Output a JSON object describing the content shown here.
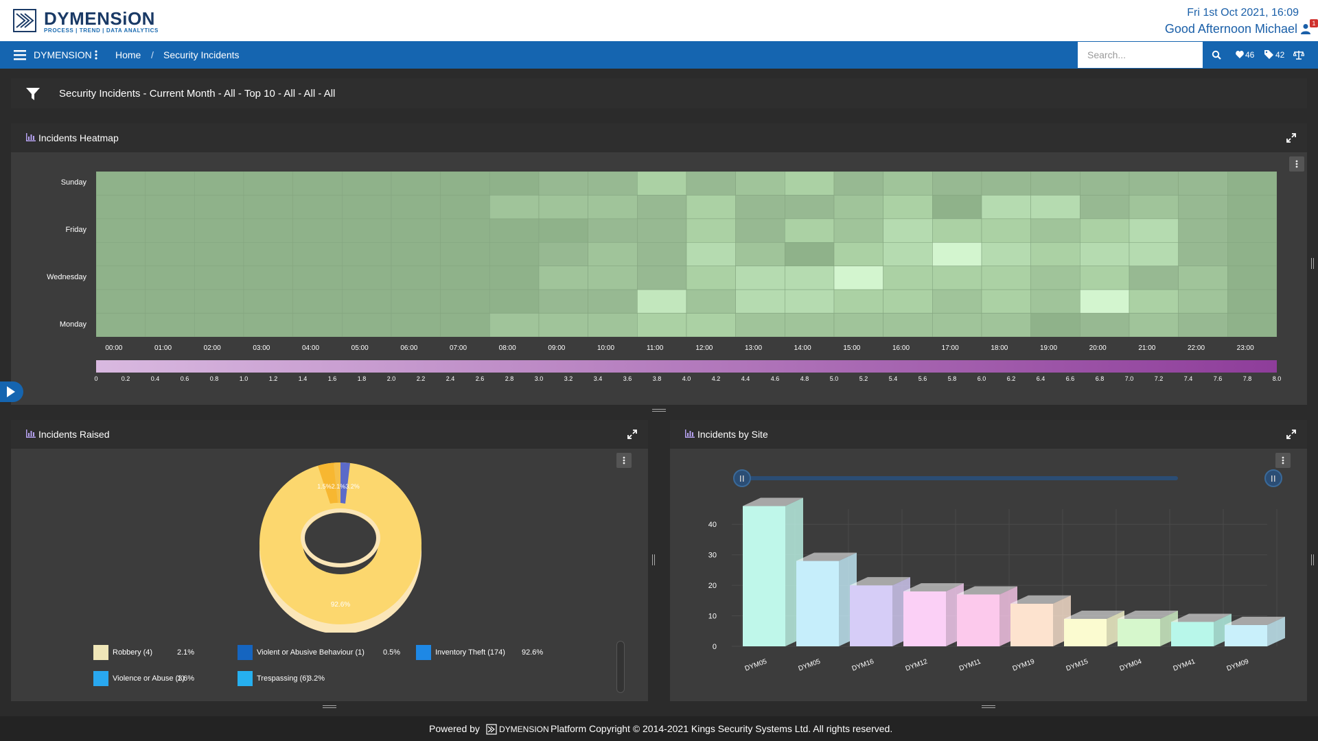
{
  "header": {
    "brand": "DYMENSiON",
    "tagline": "PROCESS | TREND | DATA ANALYTICS",
    "datetime": "Fri 1st Oct 2021, 16:09",
    "greeting": "Good Afternoon Michael",
    "notification_count": "1"
  },
  "nav": {
    "brand": "DYMENSION",
    "home": "Home",
    "separator": "/",
    "current": "Security Incidents",
    "search_placeholder": "Search...",
    "likes_count": "46",
    "tags_count": "42"
  },
  "filter": {
    "text": "Security Incidents - Current Month - All - Top 10 - All - All - All"
  },
  "heatmap": {
    "title": "Incidents Heatmap",
    "day_labels": [
      "Sunday",
      "Friday",
      "Wednesday",
      "Monday"
    ],
    "hour_labels": [
      "00:00",
      "01:00",
      "02:00",
      "03:00",
      "04:00",
      "05:00",
      "06:00",
      "07:00",
      "08:00",
      "09:00",
      "10:00",
      "11:00",
      "12:00",
      "13:00",
      "14:00",
      "15:00",
      "16:00",
      "17:00",
      "18:00",
      "19:00",
      "20:00",
      "21:00",
      "22:00",
      "23:00"
    ],
    "scale_labels": [
      "0",
      "0.2",
      "0.4",
      "0.6",
      "0.8",
      "1.0",
      "1.2",
      "1.4",
      "1.6",
      "1.8",
      "2.0",
      "2.2",
      "2.4",
      "2.6",
      "2.8",
      "3.0",
      "3.2",
      "3.4",
      "3.6",
      "3.8",
      "4.0",
      "4.2",
      "4.4",
      "4.6",
      "4.8",
      "5.0",
      "5.2",
      "5.4",
      "5.6",
      "5.8",
      "6.0",
      "6.2",
      "6.4",
      "6.6",
      "6.8",
      "7.0",
      "7.2",
      "7.4",
      "7.6",
      "7.8",
      "8.0"
    ],
    "levels": [
      [
        0,
        0,
        0,
        0,
        0,
        0,
        0,
        0,
        0,
        1,
        1,
        3,
        1,
        2,
        3,
        1,
        2,
        1,
        1,
        1,
        1,
        1,
        1,
        0
      ],
      [
        0,
        0,
        0,
        0,
        0,
        0,
        0,
        0,
        2,
        2,
        2,
        1,
        3,
        1,
        1,
        2,
        3,
        0,
        4,
        4,
        1,
        2,
        1,
        0
      ],
      [
        0,
        0,
        0,
        0,
        0,
        0,
        0,
        0,
        0,
        0,
        1,
        1,
        3,
        1,
        3,
        2,
        4,
        3,
        3,
        2,
        3,
        4,
        1,
        0
      ],
      [
        0,
        0,
        0,
        0,
        0,
        0,
        0,
        0,
        0,
        1,
        2,
        1,
        4,
        2,
        0,
        3,
        4,
        6,
        4,
        3,
        4,
        4,
        1,
        0
      ],
      [
        0,
        0,
        0,
        0,
        0,
        0,
        0,
        0,
        0,
        2,
        2,
        1,
        3,
        4,
        4,
        6,
        3,
        3,
        3,
        2,
        3,
        1,
        2,
        0
      ],
      [
        0,
        0,
        0,
        0,
        0,
        0,
        0,
        0,
        0,
        1,
        1,
        5,
        2,
        4,
        4,
        3,
        3,
        2,
        3,
        2,
        6,
        3,
        2,
        0
      ],
      [
        0,
        0,
        0,
        0,
        0,
        0,
        0,
        0,
        2,
        2,
        2,
        3,
        3,
        2,
        2,
        2,
        2,
        2,
        2,
        0,
        1,
        2,
        1,
        0
      ]
    ]
  },
  "incidents_raised": {
    "title": "Incidents Raised",
    "legend": [
      {
        "label": "Robbery (4)",
        "pct": "2.1%",
        "color": "#efe6b8"
      },
      {
        "label": "Violent or Abusive Behaviour (1)",
        "pct": "0.5%",
        "color": "#1565c0"
      },
      {
        "label": "Inventory Theft (174)",
        "pct": "92.6%",
        "color": "#1e88e5"
      },
      {
        "label": "Violence or Abuse (3)",
        "pct": "1.6%",
        "color": "#29a8f0"
      },
      {
        "label": "Trespassing (6)",
        "pct": "3.2%",
        "color": "#26b0f0"
      }
    ],
    "big_slice_label": "92.6%",
    "small_slice_labels": "1.5%2.1%3.2%"
  },
  "chart_data": {
    "type": "bar",
    "title": "Incidents by Site",
    "categories": [
      "DYM05",
      "DYM05",
      "DYM16",
      "DYM12",
      "DYM11",
      "DYM19",
      "DYM15",
      "DYM04",
      "DYM41",
      "DYM09"
    ],
    "values": [
      46,
      28,
      20,
      18,
      17,
      14,
      9,
      9,
      8,
      7
    ],
    "colors": [
      "#bff7ea",
      "#c6eefb",
      "#d6cdf7",
      "#fbd0f6",
      "#fcc9ec",
      "#fde3cf",
      "#fbfbd0",
      "#d6f7cc",
      "#b8f7ea",
      "#c9f0fb"
    ],
    "yticks": [
      "0",
      "10",
      "20",
      "30",
      "40"
    ],
    "ylim": [
      0,
      45
    ]
  },
  "footer": {
    "powered_by": "Powered by",
    "brand": "DYMENSION",
    "copyright": "Platform Copyright © 2014-2021 Kings Security Systems Ltd. All rights reserved."
  }
}
